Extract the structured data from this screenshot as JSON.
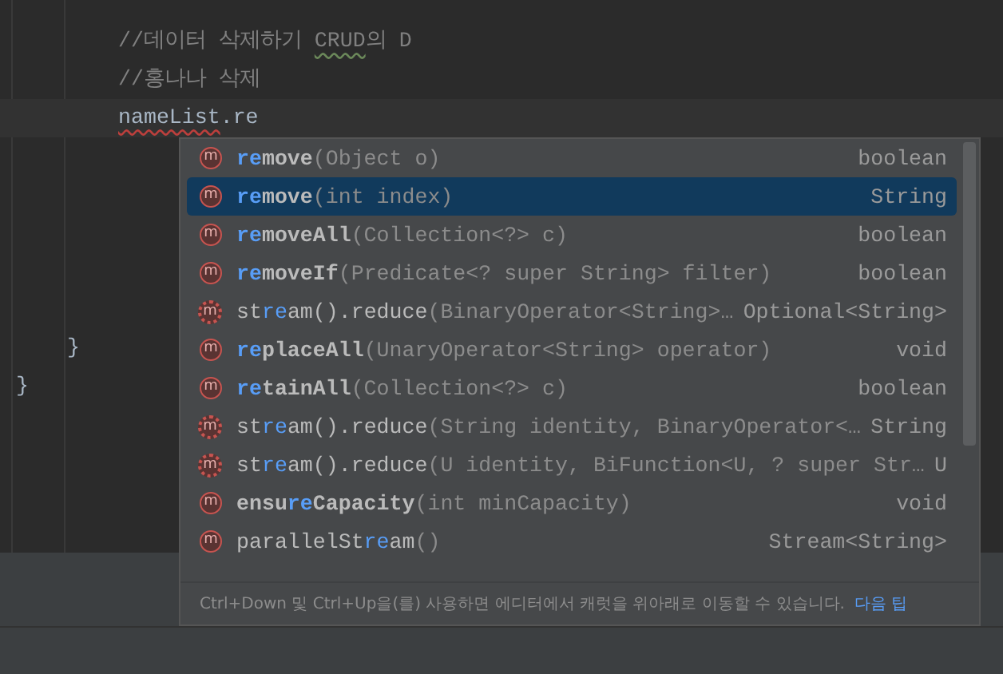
{
  "editor": {
    "children": [
      {
        "children": [
          {
            "children": [
              {
                "kind": "comment",
                "text": "//데이터 삭제하기 ",
                "warn": "CRUD",
                "after": "의 D",
                "current": false
              },
              {
                "kind": "comment",
                "text": "//홍나나 삭제",
                "current": false
              },
              {
                "kind": "code",
                "error": "nameList",
                "text": ".re",
                "current": true
              },
              {
                "kind": "blank"
              },
              {
                "kind": "blank"
              },
              {
                "kind": "blank"
              },
              {
                "kind": "blank"
              },
              {
                "kind": "blank"
              }
            ]
          },
          {
            "kind": "brace",
            "text": "}",
            "current": false
          }
        ]
      },
      {
        "kind": "brace",
        "text": "}",
        "current": false
      }
    ]
  },
  "completion": {
    "items": [
      {
        "kind": "method",
        "icon": "m",
        "selected": false,
        "match": "re",
        "after": "move",
        "bold": true,
        "params": "(Object o)",
        "type": "boolean"
      },
      {
        "kind": "method",
        "icon": "m",
        "selected": true,
        "match": "re",
        "after": "move",
        "bold": true,
        "params": "(int index)",
        "type": "String"
      },
      {
        "kind": "method",
        "icon": "m",
        "selected": false,
        "match": "re",
        "after": "moveAll",
        "bold": true,
        "params": "(Collection<?> c)",
        "type": "boolean"
      },
      {
        "kind": "method",
        "icon": "m",
        "selected": false,
        "match": "re",
        "after": "moveIf",
        "bold": true,
        "params": "(Predicate<? super String> filter)",
        "type": "boolean"
      },
      {
        "kind": "chain",
        "icon": "m",
        "selected": false,
        "before": "st",
        "match": "re",
        "after": "am().reduce",
        "bold": false,
        "params": "(BinaryOperator<String>…",
        "type": "Optional<String>"
      },
      {
        "kind": "method",
        "icon": "m",
        "selected": false,
        "match": "re",
        "after": "placeAll",
        "bold": true,
        "params": "(UnaryOperator<String> operator)",
        "type": "void"
      },
      {
        "kind": "method",
        "icon": "m",
        "selected": false,
        "match": "re",
        "after": "tainAll",
        "bold": true,
        "params": "(Collection<?> c)",
        "type": "boolean"
      },
      {
        "kind": "chain",
        "icon": "m",
        "selected": false,
        "before": "st",
        "match": "re",
        "after": "am().reduce",
        "bold": false,
        "params": "(String identity, BinaryOperator<…",
        "type": "String"
      },
      {
        "kind": "chain",
        "icon": "m",
        "selected": false,
        "before": "st",
        "match": "re",
        "after": "am().reduce",
        "bold": false,
        "params": "(U identity, BiFunction<U, ? super Str…",
        "type": "U"
      },
      {
        "kind": "method",
        "icon": "m",
        "selected": false,
        "before": "ensu",
        "match": "re",
        "after": "Capacity",
        "bold": true,
        "params": "(int minCapacity)",
        "type": "void"
      },
      {
        "kind": "method",
        "icon": "m",
        "selected": false,
        "before": "parallelSt",
        "match": "re",
        "after": "am",
        "bold": false,
        "params": "()",
        "type": "Stream<String>"
      }
    ],
    "hint": {
      "text": "Ctrl+Down 및 Ctrl+Up을(를) 사용하면 에디터에서 캐럿을 위아래로 이동할 수 있습니다.",
      "link": "다음 팁"
    }
  }
}
